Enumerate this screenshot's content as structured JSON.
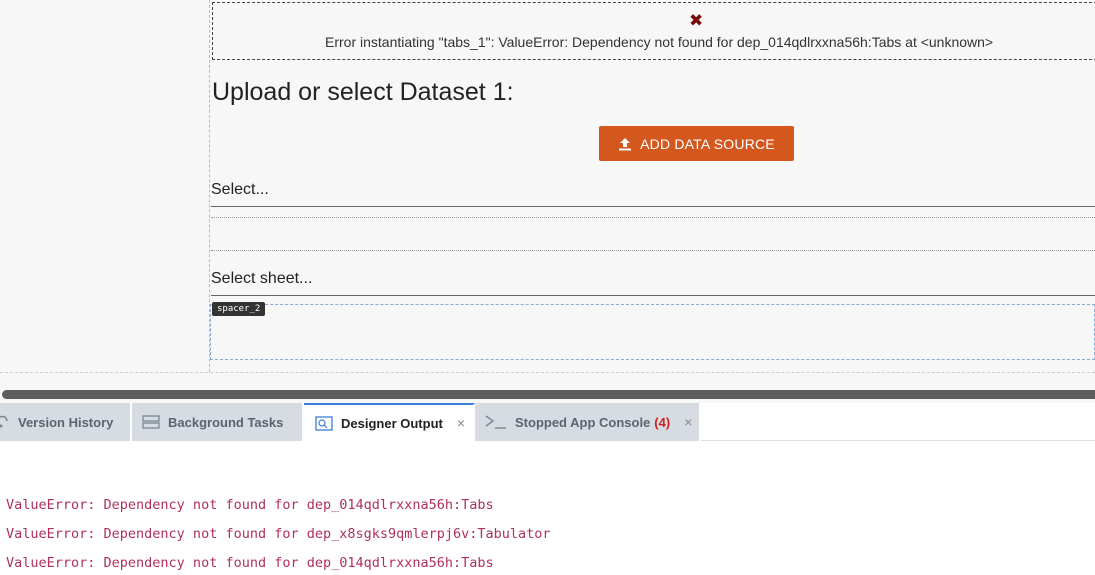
{
  "error": {
    "icon": "close-x-icon",
    "message": "Error instantiating \"tabs_1\": ValueError: Dependency not found for dep_014qdlrxxna56h:Tabs at <unknown>"
  },
  "dataset": {
    "title": "Upload or select Dataset 1:",
    "add_button_label": "ADD DATA SOURCE",
    "select_placeholder": "Select...",
    "sheet_placeholder": "Select sheet..."
  },
  "spacer": {
    "tag": "spacer_2"
  },
  "tabs": [
    {
      "label": "Version History",
      "icon": "history-icon"
    },
    {
      "label": "Background Tasks",
      "icon": "tasks-icon"
    },
    {
      "label": "Designer Output",
      "icon": "output-icon",
      "close": "×"
    },
    {
      "label": "Stopped App Console",
      "icon": "terminal-icon",
      "count": "(4)",
      "close": "×"
    }
  ],
  "console": {
    "lines": [
      "ValueError: Dependency not found for dep_014qdlrxxna56h:Tabs",
      "ValueError: Dependency not found for dep_x8sgks9qmlerpj6v:Tabulator",
      "ValueError: Dependency not found for dep_014qdlrxxna56h:Tabs"
    ]
  },
  "colors": {
    "accent": "#d4581e",
    "error_icon": "#7a0b0b",
    "active_tab": "#3b7dd8",
    "log_text": "#b0305a"
  }
}
